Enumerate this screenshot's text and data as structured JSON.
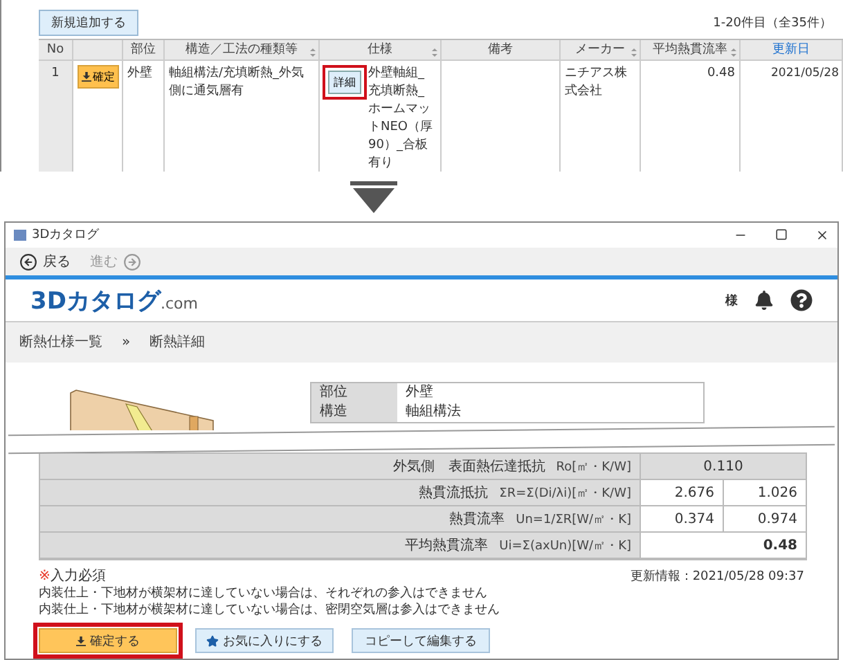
{
  "list_panel": {
    "add_button": "新規追加する",
    "count": "1-20件目（全35件）",
    "columns": [
      {
        "label": "No",
        "kind": "plain",
        "sortable": false
      },
      {
        "kind": "blank",
        "sortable": false
      },
      {
        "label": "部位",
        "kind": "plain",
        "sortable": false
      },
      {
        "label": "構造／工法の種類等",
        "kind": "plain",
        "sortable": true
      },
      {
        "label": "仕様",
        "kind": "plain",
        "sortable": true
      },
      {
        "label": "備考",
        "kind": "plain",
        "sortable": false
      },
      {
        "label": "メーカー",
        "kind": "plain",
        "sortable": true
      },
      {
        "label": "平均熱貫流率",
        "kind": "plain",
        "sortable": true
      },
      {
        "label": "更新日",
        "kind": "link",
        "sortable": false
      }
    ],
    "row": {
      "no": "1",
      "confirm_button": "確定",
      "part": "外壁",
      "structure": "軸組構法/充填断熱_外気側に通気層有",
      "detail_button": "詳細",
      "detail_highlighted": true,
      "spec": "外壁軸組_充填断熱_ホームマットNEO（厚90）_合板有り",
      "maker": "ニチアス株式会社",
      "u_value": "0.48",
      "updated": "2021/05/28"
    }
  },
  "window": {
    "title": "3Dカタログ",
    "nav": [
      {
        "label": "戻る",
        "kind": "back",
        "disabled": false
      },
      {
        "label": "進む",
        "kind": "forward",
        "disabled": true
      }
    ],
    "logo": {
      "main": "3Dカタログ",
      "suffix": ".com"
    },
    "user_suffix": "様",
    "breadcrumb": {
      "items": [
        "断熱仕様一覧",
        "断熱詳細"
      ],
      "separator": "»"
    },
    "spec": [
      {
        "label": "部位",
        "value": "外壁"
      },
      {
        "label": "構造",
        "value": "軸組構法"
      }
    ],
    "thermal_rows": [
      {
        "kind": "single",
        "label": "外気側　表面熱伝達抵抗",
        "formula": "Ro[㎡・K/W]",
        "values": [
          "0.110"
        ]
      },
      {
        "kind": "pair",
        "label": "熱貫流抵抗",
        "formula": "ΣR=Σ(Di/λi)[㎡・K/W]",
        "values": [
          "2.676",
          "1.026"
        ]
      },
      {
        "kind": "pair",
        "label": "熱貫流率",
        "formula": "Un=1/ΣR[W/㎡・K]",
        "values": [
          "0.374",
          "0.974"
        ]
      },
      {
        "kind": "total",
        "label": "平均熱貫流率",
        "formula": "Ui=Σ(axUn)[W/㎡・K]",
        "values": [
          "0.48"
        ]
      }
    ],
    "required_mark": "※",
    "required_label": "入力必須",
    "updated": "更新情報：2021/05/28 09:37",
    "notes": [
      "内装仕上・下地材が横架材に達していない場合は、それぞれの参入はできません",
      "内装仕上・下地材が横架材に達していない場合は、密閉空気層は参入はできません"
    ],
    "buttons": [
      {
        "label": "確定する",
        "kind": "primary",
        "highlighted": true
      },
      {
        "label": "お気に入りにする",
        "kind": "favorite",
        "highlighted": false
      },
      {
        "label": "コピーして編集する",
        "kind": "plain",
        "highlighted": false
      }
    ]
  }
}
